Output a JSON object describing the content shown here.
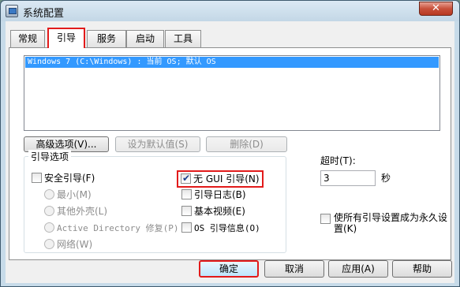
{
  "window": {
    "title": "系统配置",
    "close_label": "✕"
  },
  "tabs": [
    {
      "label": "常规"
    },
    {
      "label": "引导"
    },
    {
      "label": "服务"
    },
    {
      "label": "启动"
    },
    {
      "label": "工具"
    }
  ],
  "active_tab": "引导",
  "os_list": [
    "Windows 7 (C:\\Windows) : 当前 OS; 默认 OS"
  ],
  "list_buttons": {
    "advanced": "高级选项(V)...",
    "set_default": "设为默认值(S)",
    "delete": "删除(D)"
  },
  "boot_options": {
    "group_label": "引导选项",
    "safe_boot": "安全引导(F)",
    "minimal": "最小(M)",
    "alt_shell": "其他外壳(L)",
    "ad_repair": "Active Directory 修复(P)",
    "network": "网络(W)",
    "no_gui": "无 GUI 引导(N)",
    "boot_log": "引导日志(B)",
    "base_video": "基本视频(E)",
    "os_boot_info": "OS 引导信息(O)"
  },
  "checked": {
    "no_gui": true,
    "safe_boot": false,
    "boot_log": false,
    "base_video": false,
    "os_boot_info": false,
    "permanent": false
  },
  "timeout": {
    "label": "超时(T):",
    "value": "3",
    "unit": "秒"
  },
  "permanent_label": "使所有引导设置成为永久设置(K)",
  "dialog_buttons": {
    "ok": "确定",
    "cancel": "取消",
    "apply": "应用(A)",
    "help": "帮助"
  },
  "colors": {
    "highlight_box": "#e21b1b",
    "selection": "#3399ff"
  }
}
